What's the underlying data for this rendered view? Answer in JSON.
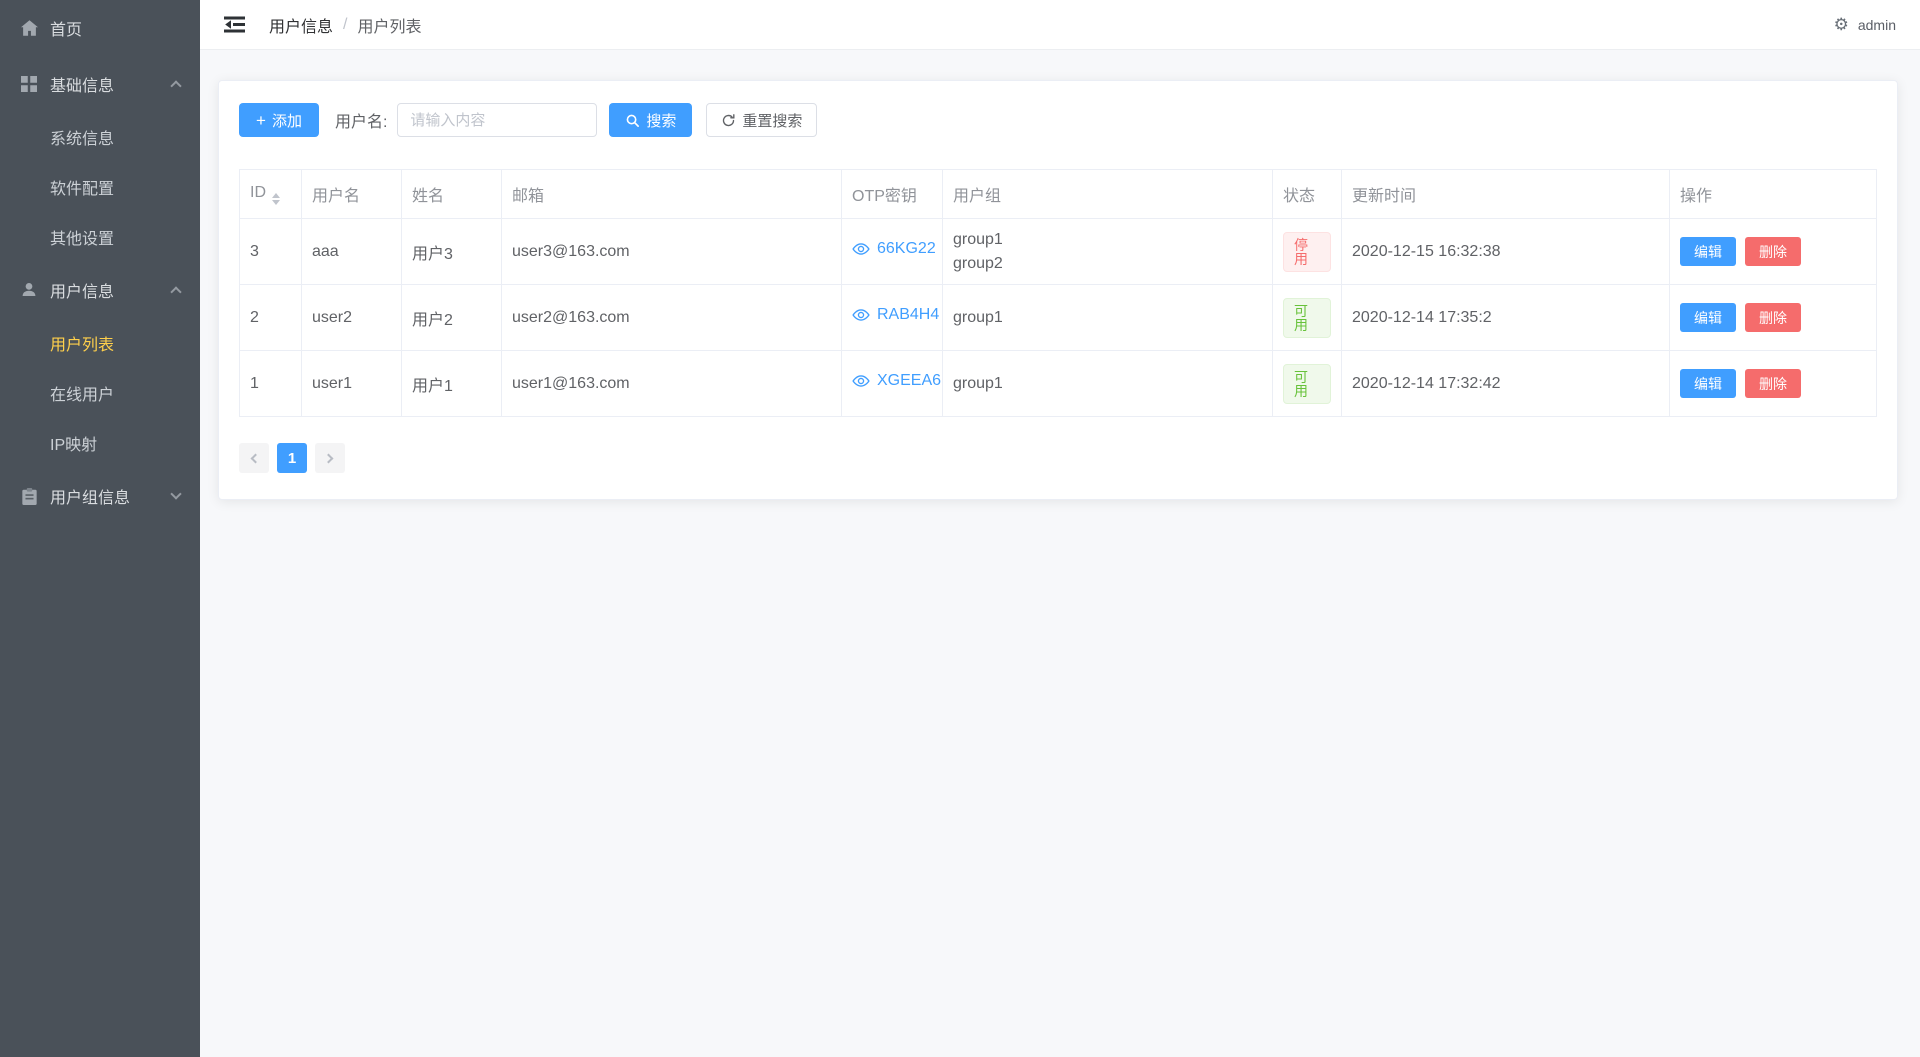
{
  "colors": {
    "primary": "#409eff",
    "danger": "#f56c6c",
    "success": "#67c23a",
    "sidebar_bg": "#4a5159",
    "sidebar_active_text": "#ffd04b"
  },
  "sidebar": {
    "items": [
      {
        "label": "首页",
        "icon": "home",
        "type": "item"
      },
      {
        "label": "基础信息",
        "icon": "grid",
        "type": "group",
        "expanded": true,
        "children": [
          {
            "label": "系统信息",
            "active": false
          },
          {
            "label": "软件配置",
            "active": false
          },
          {
            "label": "其他设置",
            "active": false
          }
        ]
      },
      {
        "label": "用户信息",
        "icon": "user",
        "type": "group",
        "expanded": true,
        "children": [
          {
            "label": "用户列表",
            "active": true
          },
          {
            "label": "在线用户",
            "active": false
          },
          {
            "label": "IP映射",
            "active": false
          }
        ]
      },
      {
        "label": "用户组信息",
        "icon": "clipboard",
        "type": "group",
        "expanded": false,
        "children": []
      }
    ]
  },
  "header": {
    "breadcrumb": [
      "用户信息",
      "用户列表"
    ],
    "separator": "/",
    "gear_glyph": "⚙",
    "user": "admin"
  },
  "toolbar": {
    "add_label": "添加",
    "add_icon_glyph": "+",
    "username_label": "用户名:",
    "search_placeholder": "请输入内容",
    "search_label": "搜索",
    "reset_label": "重置搜索"
  },
  "icons_legend": {
    "fold-icon": "three bars with left arrow",
    "search-icon": "magnifier",
    "refresh-icon": "circular arrow",
    "eye-icon": "outlined eye",
    "gear-icon": "unicode gear"
  },
  "table": {
    "columns": [
      "ID",
      "用户名",
      "姓名",
      "邮箱",
      "OTP密钥",
      "用户组",
      "状态",
      "更新时间",
      "操作"
    ],
    "sortable_column": "ID",
    "edit_label": "编辑",
    "delete_label": "删除",
    "rows": [
      {
        "id": "3",
        "username": "aaa",
        "name": "用户3",
        "email": "user3@163.com",
        "otp": "66KG22",
        "groups": [
          "group1",
          "group2"
        ],
        "status": "停用",
        "status_type": "danger",
        "updated": "2020-12-15 16:32:38"
      },
      {
        "id": "2",
        "username": "user2",
        "name": "用户2",
        "email": "user2@163.com",
        "otp": "RAB4H4",
        "groups": [
          "group1"
        ],
        "status": "可用",
        "status_type": "success",
        "updated": "2020-12-14 17:35:2"
      },
      {
        "id": "1",
        "username": "user1",
        "name": "用户1",
        "email": "user1@163.com",
        "otp": "XGEEA6",
        "groups": [
          "group1"
        ],
        "status": "可用",
        "status_type": "success",
        "updated": "2020-12-14 17:32:42"
      }
    ]
  },
  "pagination": {
    "current": "1",
    "pages": [
      "1"
    ]
  }
}
